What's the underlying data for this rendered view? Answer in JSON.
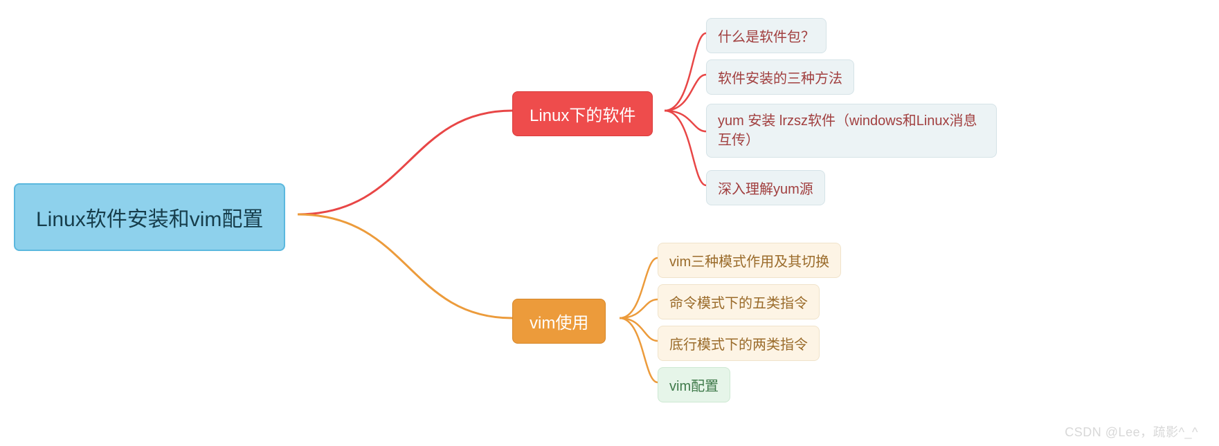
{
  "root": {
    "label": "Linux软件安装和vim配置"
  },
  "branch1": {
    "label": "Linux下的软件",
    "children": [
      {
        "label": "什么是软件包？"
      },
      {
        "label": "软件安装的三种方法"
      },
      {
        "label": "yum 安装 lrzsz软件（windows和Linux消息互传）"
      },
      {
        "label": "深入理解yum源"
      }
    ]
  },
  "branch2": {
    "label": "vim使用",
    "children": [
      {
        "label": "vim三种模式作用及其切换"
      },
      {
        "label": "命令模式下的五类指令"
      },
      {
        "label": "底行模式下的两类指令"
      },
      {
        "label": "vim配置"
      }
    ]
  },
  "watermark": "CSDN @Lee，疏影^_^",
  "colors": {
    "root_bg": "#8ed1ec",
    "branch1_bg": "#ee4c4c",
    "branch2_bg": "#ec9b3b",
    "edge_red": "#e84646",
    "edge_orange": "#ec9b3b"
  }
}
